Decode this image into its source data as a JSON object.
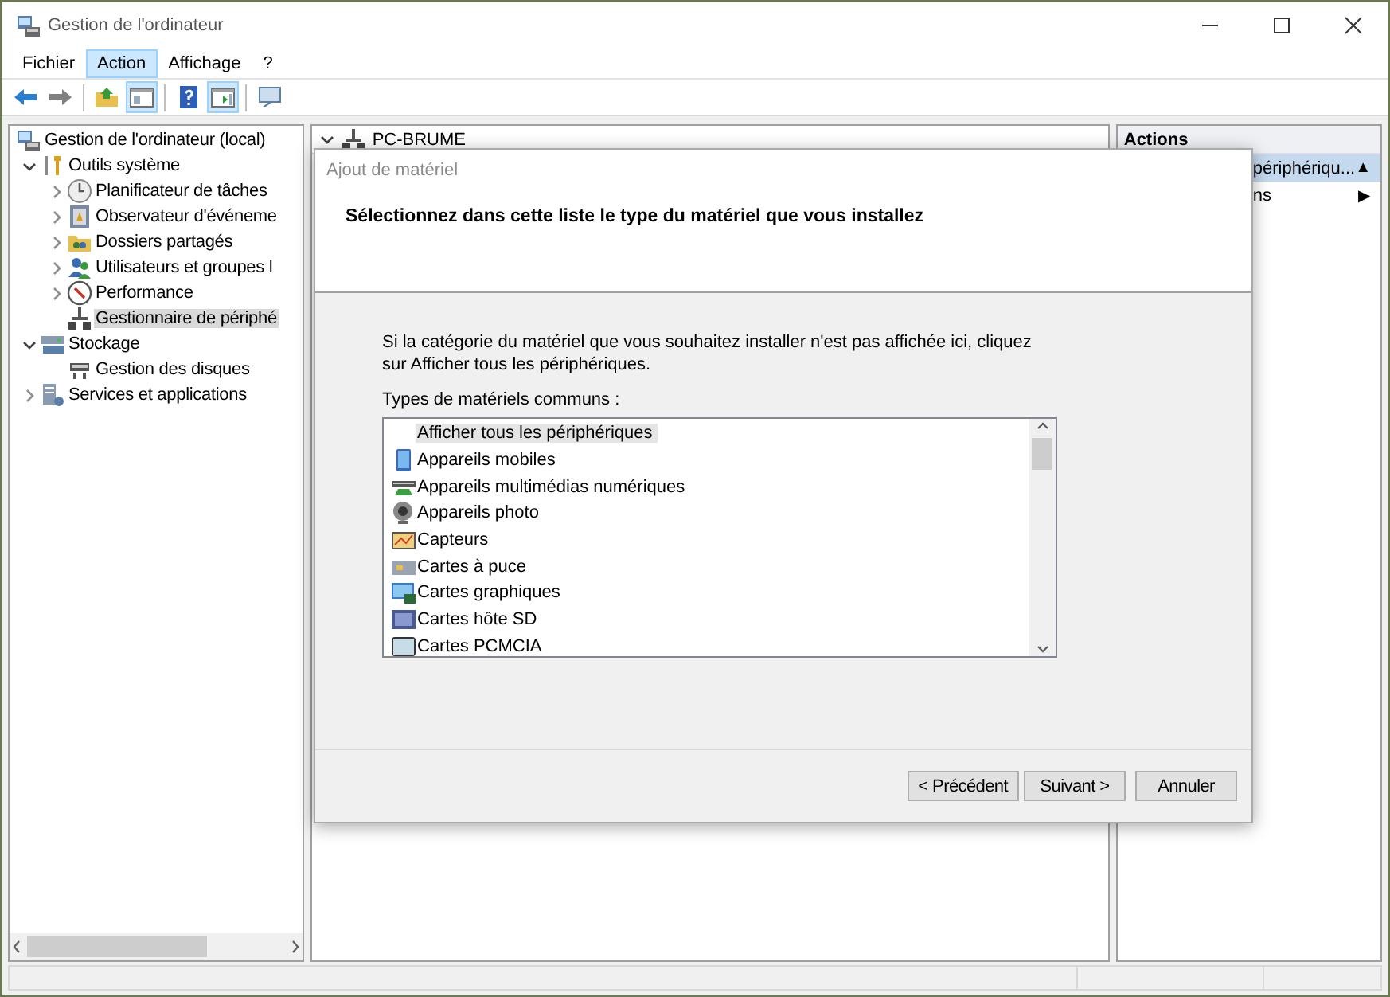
{
  "window": {
    "title": "Gestion de l'ordinateur"
  },
  "menu": [
    {
      "label": "Fichier",
      "selected": false
    },
    {
      "label": "Action",
      "selected": true
    },
    {
      "label": "Affichage",
      "selected": false
    },
    {
      "label": "?",
      "selected": false
    }
  ],
  "toolbar": [
    {
      "kind": "back",
      "pressed": false
    },
    {
      "kind": "forward",
      "pressed": false
    },
    {
      "kind": "up",
      "pressed": false
    },
    {
      "kind": "tree",
      "pressed": true
    },
    {
      "kind": "help",
      "pressed": false
    },
    {
      "kind": "actionpane",
      "pressed": true
    },
    {
      "kind": "monitor",
      "pressed": false
    }
  ],
  "tree": {
    "items": [
      {
        "label": "Gestion de l'ordinateur (local)",
        "selected": false,
        "children": [
          {
            "label": "Outils système",
            "expanded": true,
            "selected": false,
            "children": [
              {
                "label": "Planificateur de tâches",
                "expanded": false,
                "selected": false
              },
              {
                "label": "Observateur d'événeme",
                "expanded": false,
                "selected": false
              },
              {
                "label": "Dossiers partagés",
                "expanded": false,
                "selected": false
              },
              {
                "label": "Utilisateurs et groupes l",
                "expanded": false,
                "selected": false
              },
              {
                "label": "Performance",
                "expanded": false,
                "selected": false
              },
              {
                "label": "Gestionnaire de périphé",
                "selected": true
              }
            ]
          },
          {
            "label": "Stockage",
            "expanded": true,
            "selected": false,
            "children": [
              {
                "label": "Gestion des disques",
                "selected": false
              }
            ]
          },
          {
            "label": "Services et applications",
            "expanded": false,
            "selected": false
          }
        ]
      }
    ]
  },
  "center": {
    "title": "PC-BRUME"
  },
  "actions": {
    "title": "Actions",
    "items": [
      {
        "label": "périphériqu...",
        "arrow": "▲",
        "selected": true
      },
      {
        "label": "ns",
        "arrow": "▶",
        "selected": false
      }
    ]
  },
  "dialog": {
    "title": "Ajout de matériel",
    "heading": "Sélectionnez dans cette liste le type du matériel que vous installez",
    "instructions": "Si la catégorie du matériel que vous souhaitez installer n'est pas affichée ici, cliquez sur Afficher tous les périphériques.",
    "list_label": "Types de matériels communs :",
    "items": [
      {
        "label": "Afficher tous les périphériques",
        "kind": "all",
        "selected": true
      },
      {
        "label": "Appareils mobiles",
        "kind": "device",
        "selected": false
      },
      {
        "label": "Appareils multimédias numériques",
        "kind": "device",
        "selected": false
      },
      {
        "label": "Appareils photo",
        "kind": "device",
        "selected": false
      },
      {
        "label": "Capteurs",
        "kind": "device",
        "selected": false
      },
      {
        "label": "Cartes à puce",
        "kind": "device",
        "selected": false
      },
      {
        "label": "Cartes graphiques",
        "kind": "device",
        "selected": false
      },
      {
        "label": "Cartes hôte SD",
        "kind": "device",
        "selected": false
      },
      {
        "label": "Cartes PCMCIA",
        "kind": "device",
        "selected": false
      }
    ],
    "buttons": [
      {
        "label": "< Précédent"
      },
      {
        "label": "Suivant >"
      },
      {
        "label": "Annuler"
      }
    ]
  }
}
